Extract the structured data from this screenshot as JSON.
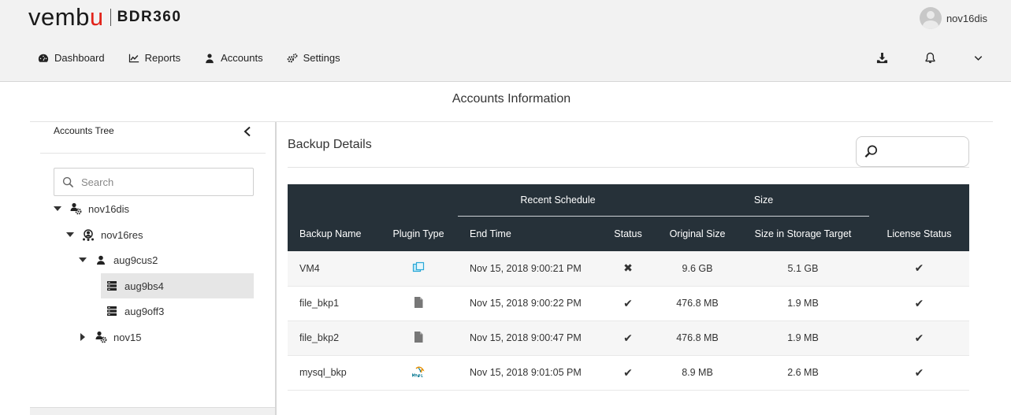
{
  "app": {
    "brand_pre": "vemb",
    "brand_u": "u",
    "product": "BDR360",
    "username": "nov16dis"
  },
  "nav": {
    "dashboard": "Dashboard",
    "reports": "Reports",
    "accounts": "Accounts",
    "settings": "Settings"
  },
  "page_title": "Accounts Information",
  "sidebar": {
    "title": "Accounts Tree",
    "search_placeholder": "Search",
    "tree": [
      {
        "label": "nov16dis",
        "expanded": true,
        "icon": "distributor-icon"
      },
      {
        "label": "nov16res",
        "expanded": true,
        "icon": "reseller-icon"
      },
      {
        "label": "aug9cus2",
        "expanded": true,
        "icon": "customer-icon"
      },
      {
        "label": "aug9bs4",
        "selected": true,
        "icon": "server-icon"
      },
      {
        "label": "aug9off3",
        "icon": "server-icon"
      },
      {
        "label": "nov15",
        "expanded": false,
        "icon": "distributor-icon"
      }
    ]
  },
  "content": {
    "title": "Backup Details"
  },
  "table": {
    "group_headers": {
      "recent_schedule": "Recent Schedule",
      "size": "Size"
    },
    "columns": {
      "backup_name": "Backup Name",
      "plugin_type": "Plugin Type",
      "end_time": "End Time",
      "status": "Status",
      "original_size": "Original Size",
      "storage_size": "Size in Storage Target",
      "license_status": "License Status"
    },
    "rows": [
      {
        "name": "VM4",
        "plugin": "vm-icon",
        "end_time": "Nov 15, 2018 9:00:21 PM",
        "status": "failed",
        "original_size": "9.6 GB",
        "storage_size": "5.1 GB",
        "license": "ok"
      },
      {
        "name": "file_bkp1",
        "plugin": "file-icon",
        "end_time": "Nov 15, 2018 9:00:22 PM",
        "status": "success",
        "original_size": "476.8 MB",
        "storage_size": "1.9 MB",
        "license": "ok"
      },
      {
        "name": "file_bkp2",
        "plugin": "file-icon",
        "end_time": "Nov 15, 2018 9:00:47 PM",
        "status": "success",
        "original_size": "476.8 MB",
        "storage_size": "1.9 MB",
        "license": "ok"
      },
      {
        "name": "mysql_bkp",
        "plugin": "mysql-icon",
        "end_time": "Nov 15, 2018 9:01:05 PM",
        "status": "success",
        "original_size": "8.9 MB",
        "storage_size": "2.6 MB",
        "license": "ok"
      }
    ]
  },
  "colors": {
    "header_bg": "#f2f2f2",
    "table_header_bg": "#263139",
    "success": "#6db33f",
    "failure": "#d9534f",
    "brand_accent": "#e2231a"
  }
}
